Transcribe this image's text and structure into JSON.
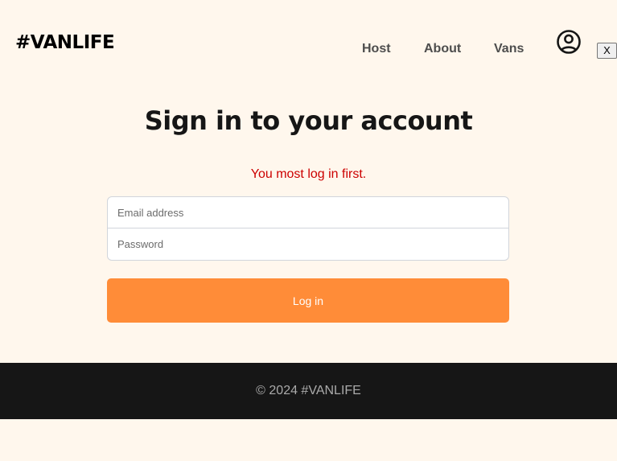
{
  "header": {
    "logo": "#VANLIFE",
    "nav": {
      "host": "Host",
      "about": "About",
      "vans": "Vans"
    },
    "avatar_icon": "user-circle-icon",
    "close_label": "X"
  },
  "main": {
    "title": "Sign in to your account",
    "error": "You most log in first.",
    "email_placeholder": "Email address",
    "password_placeholder": "Password",
    "login_label": "Log in"
  },
  "footer": {
    "copyright": "© 2024 #VANLIFE"
  },
  "colors": {
    "background": "#FFF7ED",
    "accent": "#FF8C38",
    "error": "#CC0000",
    "footer_bg": "#161616"
  }
}
